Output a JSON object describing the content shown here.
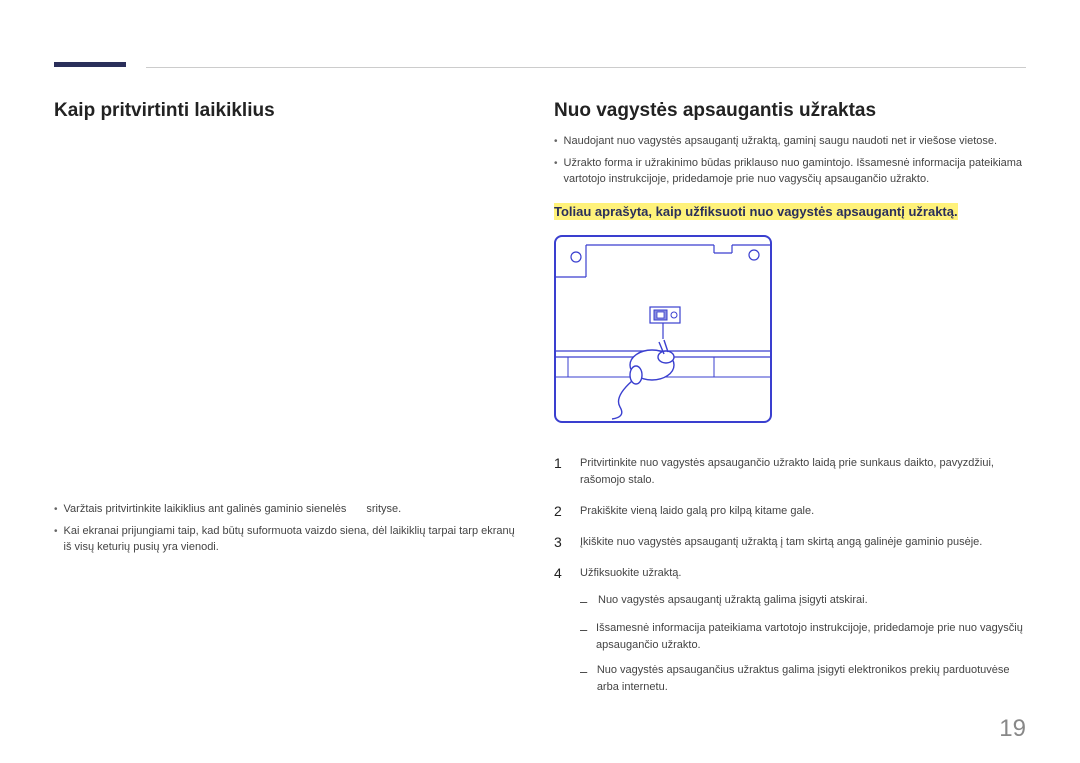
{
  "left": {
    "heading": "Kaip pritvirtinti laikiklius",
    "bullets": [
      {
        "pre": "Varžtais pritvirtinkite laikiklius ant galinės gaminio sienelės",
        "post": "srityse."
      },
      {
        "text": "Kai ekranai prijungiami taip, kad būtų suformuota vaizdo siena, dėl laikiklių tarpai tarp ekranų iš visų keturių pusių yra vienodi."
      }
    ]
  },
  "right": {
    "heading": "Nuo vagystės apsaugantis užraktas",
    "bullets": [
      "Naudojant nuo vagystės apsaugantį užraktą, gaminį saugu naudoti net ir viešose vietose.",
      "Užrakto forma ir užrakinimo būdas priklauso nuo gamintojo. Išsamesnė informacija pateikiama vartotojo instrukcijoje, pridedamoje prie nuo vagysčių apsaugančio užrakto."
    ],
    "highlight": "Toliau aprašyta, kaip užfiksuoti nuo vagystės apsaugantį užraktą.",
    "steps": [
      {
        "n": "1",
        "text": "Pritvirtinkite nuo vagystės apsaugančio užrakto laidą prie sunkaus daikto, pavyzdžiui, rašomojo stalo."
      },
      {
        "n": "2",
        "text": "Prakiškite vieną laido galą pro kilpą kitame gale."
      },
      {
        "n": "3",
        "text": "Įkiškite nuo vagystės apsaugantį užraktą į tam skirtą angą galinėje gaminio pusėje."
      },
      {
        "n": "4",
        "text": "Užfiksuokite užraktą."
      }
    ],
    "subnotes": [
      "Nuo vagystės apsaugantį užraktą galima įsigyti atskirai.",
      "Išsamesnė informacija pateikiama vartotojo instrukcijoje, pridedamoje prie nuo vagysčių apsaugančio užrakto.",
      "Nuo vagystės apsaugančius užraktus galima įsigyti elektronikos prekių parduotuvėse arba internetu."
    ]
  },
  "page": "19"
}
